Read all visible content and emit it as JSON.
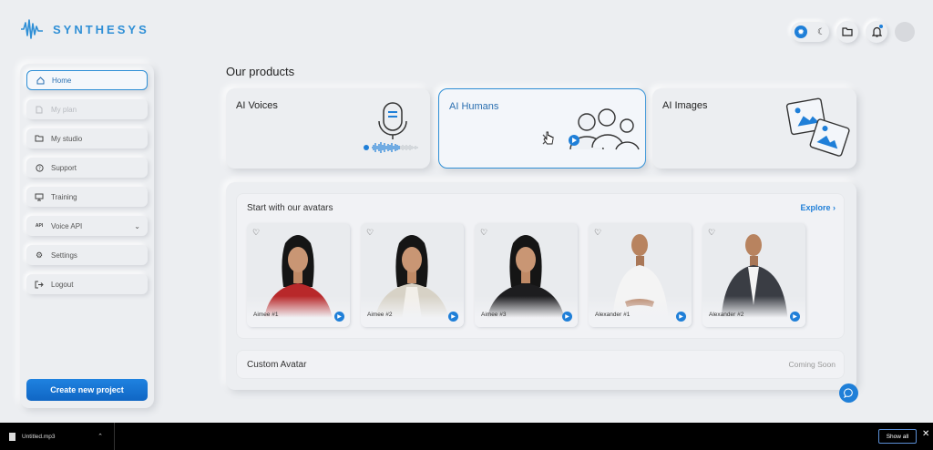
{
  "app": {
    "name": "SYNTHESYS"
  },
  "colors": {
    "accent": "#1f7fd8",
    "background": "#eceef1",
    "download_bar": "#000000"
  },
  "header": {
    "icons": [
      "sun-icon",
      "moon-icon",
      "folder-icon",
      "bell-icon",
      "user-avatar"
    ]
  },
  "sidebar": {
    "items": [
      {
        "label": "Home",
        "icon": "home-icon",
        "state": "active"
      },
      {
        "label": "My plan",
        "icon": "document-icon",
        "state": "disabled"
      },
      {
        "label": "My studio",
        "icon": "folder-icon",
        "state": "normal"
      },
      {
        "label": "Support",
        "icon": "help-icon",
        "state": "normal"
      },
      {
        "label": "Training",
        "icon": "presentation-icon",
        "state": "normal"
      },
      {
        "label": "Voice API",
        "icon": "api-icon",
        "state": "normal"
      },
      {
        "label": "Settings",
        "icon": "gear-icon",
        "state": "normal"
      },
      {
        "label": "Logout",
        "icon": "logout-icon",
        "state": "normal"
      }
    ],
    "create_button": "Create new project"
  },
  "main": {
    "section_title": "Our products",
    "products": [
      {
        "label": "AI Voices",
        "selected": false
      },
      {
        "label": "AI Humans",
        "selected": true
      },
      {
        "label": "AI Images",
        "selected": false
      }
    ],
    "avatars_section": {
      "title": "Start with our avatars",
      "explore": "Explore",
      "avatars": [
        {
          "name": "Aimee #1",
          "outfit": "#b8282a",
          "gender": "female"
        },
        {
          "name": "Aimee #2",
          "outfit": "#d7d2c6",
          "gender": "female"
        },
        {
          "name": "Aimee #3",
          "outfit": "#1d1d1f",
          "gender": "female"
        },
        {
          "name": "Alexander #1",
          "outfit": "#f4f4f4",
          "gender": "male"
        },
        {
          "name": "Alexander #2",
          "outfit": "#3a3d44",
          "gender": "male"
        }
      ]
    },
    "custom_avatar": {
      "title": "Custom Avatar",
      "status": "Coming Soon"
    }
  },
  "download_bar": {
    "file_name": "Untitled.mp3",
    "show_all": "Show all"
  }
}
